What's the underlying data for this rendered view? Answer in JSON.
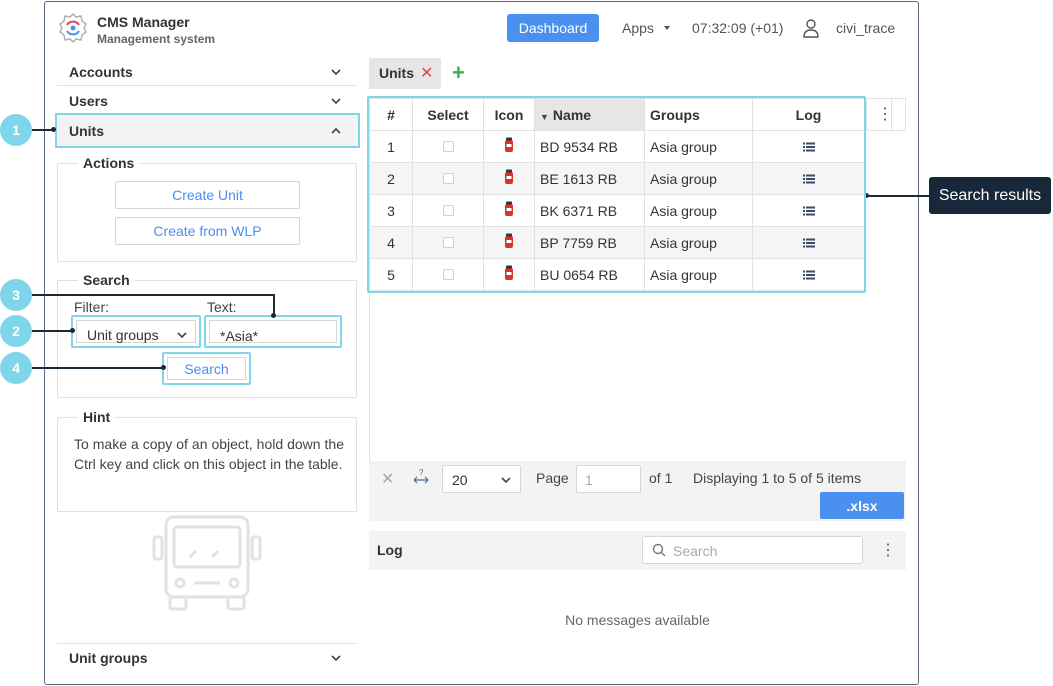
{
  "header": {
    "app_title": "CMS Manager",
    "app_subtitle": "Management system",
    "dashboard_label": "Dashboard",
    "apps_label": "Apps",
    "clock": "07:32:09 (+01)",
    "username": "civi_trace"
  },
  "sidebar": {
    "accounts": "Accounts",
    "users": "Users",
    "units": "Units",
    "unit_groups": "Unit groups",
    "actions": {
      "title": "Actions",
      "create_unit": "Create Unit",
      "create_from_wlp": "Create from WLP"
    },
    "search": {
      "title": "Search",
      "filter_label": "Filter:",
      "filter_value": "Unit groups",
      "text_label": "Text:",
      "text_value": "*Asia*",
      "button": "Search"
    },
    "hint": {
      "title": "Hint",
      "text": "To make a copy of an object, hold down the Ctrl key and click on this object in the table."
    }
  },
  "callouts": [
    "1",
    "2",
    "3",
    "4"
  ],
  "search_results_tag": "Search results",
  "tab": {
    "label": "Units",
    "close": "✕",
    "add": "+"
  },
  "table": {
    "headers": {
      "num": "#",
      "select": "Select",
      "icon": "Icon",
      "name": "Name",
      "groups": "Groups",
      "log": "Log"
    },
    "rows": [
      {
        "num": "1",
        "name": "BD 9534 RB",
        "groups": "Asia group"
      },
      {
        "num": "2",
        "name": "BE 1613 RB",
        "groups": "Asia group"
      },
      {
        "num": "3",
        "name": "BK 6371 RB",
        "groups": "Asia group"
      },
      {
        "num": "4",
        "name": "BP 7759 RB",
        "groups": "Asia group"
      },
      {
        "num": "5",
        "name": "BU 0654 RB",
        "groups": "Asia group"
      }
    ]
  },
  "pager": {
    "page_size": "20",
    "page_label": "Page",
    "page_value": "1",
    "of_label": "of 1",
    "info": "Displaying 1 to 5 of 5 items",
    "xlsx": ".xlsx"
  },
  "log": {
    "title": "Log",
    "search_placeholder": "Search",
    "empty": "No messages available"
  },
  "colors": {
    "accent": "#4a90f0",
    "highlight": "#7fd6ea",
    "dark": "#172838",
    "add": "#3bb24a",
    "close": "#e04848"
  }
}
